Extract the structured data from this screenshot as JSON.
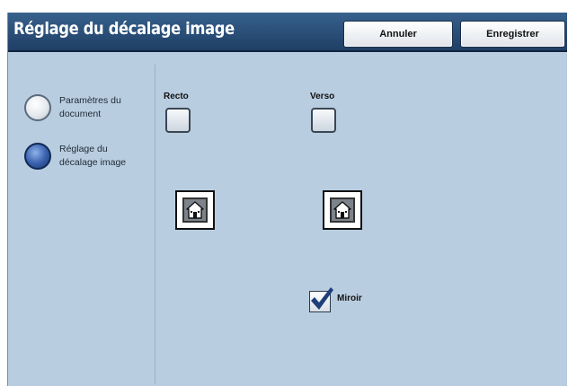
{
  "header": {
    "title": "Réglage du décalage image",
    "cancel_label": "Annuler",
    "save_label": "Enregistrer"
  },
  "sidebar": {
    "options": [
      {
        "label": "Paramètres du document",
        "selected": false
      },
      {
        "label": "Réglage du décalage image",
        "selected": true
      }
    ]
  },
  "main": {
    "recto_label": "Recto",
    "verso_label": "Verso",
    "mirror": {
      "label": "Miroir",
      "checked": true
    }
  },
  "colors": {
    "background": "#b9cde0",
    "titlebar": "#2a4d78",
    "selected_radio": "#2a4f9c",
    "checkmark": "#1f3f7a"
  }
}
